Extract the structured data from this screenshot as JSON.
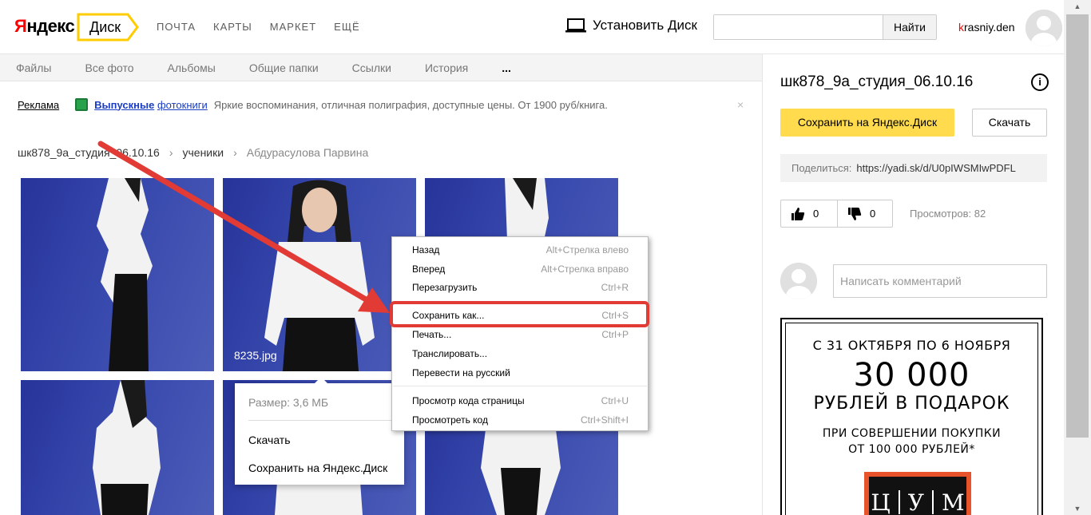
{
  "header": {
    "logo": "Яндекс",
    "service": "Диск",
    "nav": [
      "ПОЧТА",
      "КАРТЫ",
      "МАРКЕТ",
      "ЕЩЁ"
    ],
    "install_label": "Установить Диск",
    "search": {
      "value": "",
      "placeholder": "",
      "button": "Найти"
    },
    "username_first": "k",
    "username_rest": "rasniy.den"
  },
  "subnav": [
    "Файлы",
    "Все фото",
    "Альбомы",
    "Общие папки",
    "Ссылки",
    "История",
    "..."
  ],
  "ad": {
    "label": "Реклама",
    "link_bold": "Выпускные",
    "link": "фотокниги",
    "text": "Яркие воспоминания, отличная полиграфия, доступные цены. От 1900 руб/книга.",
    "close": "×"
  },
  "breadcrumb": {
    "items": [
      "шк878_9а_студия_06.10.16",
      "ученики"
    ],
    "current": "Абдурасулова Парвина",
    "separator": "›"
  },
  "photos": {
    "selected_name": "8235.jpg"
  },
  "file_popup": {
    "size": "Размер: 3,6 МБ",
    "download": "Скачать",
    "save": "Сохранить на Яндекс.Диск"
  },
  "context_menu": [
    {
      "label": "Назад",
      "shortcut": "Alt+Стрелка влево"
    },
    {
      "label": "Вперед",
      "shortcut": "Alt+Стрелка вправо"
    },
    {
      "label": "Перезагрузить",
      "shortcut": "Ctrl+R"
    },
    {
      "label": "Сохранить как...",
      "shortcut": "Ctrl+S"
    },
    {
      "label": "Печать...",
      "shortcut": "Ctrl+P"
    },
    {
      "label": "Транслировать...",
      "shortcut": ""
    },
    {
      "label": "Перевести на русский",
      "shortcut": ""
    },
    {
      "label": "Просмотр кода страницы",
      "shortcut": "Ctrl+U"
    },
    {
      "label": "Просмотреть код",
      "shortcut": "Ctrl+Shift+I"
    }
  ],
  "sidebar": {
    "title": "шк878_9а_студия_06.10.16",
    "info": "i",
    "save_button": "Сохранить на Яндекс.Диск",
    "download_button": "Скачать",
    "share_label": "Поделиться:",
    "share_url": "https://yadi.sk/d/U0pIWSMIwPDFL",
    "likes": "0",
    "dislikes": "0",
    "views": "Просмотров: 82",
    "comment_placeholder": "Написать комментарий"
  },
  "banner": {
    "line1": "С 31 ОКТЯБРЯ ПО 6 НОЯБРЯ",
    "line2": "30 000",
    "line3": "РУБЛЕЙ В ПОДАРОК",
    "line4": "ПРИ СОВЕРШЕНИИ ПОКУПКИ",
    "line5": "ОТ 100 000 РУБЛЕЙ*",
    "brand": [
      "Ц",
      "У",
      "М"
    ]
  },
  "colors": {
    "accent_yellow": "#ffdb4d",
    "highlight_red": "#e23a34",
    "link_blue": "#1a3dc1"
  }
}
